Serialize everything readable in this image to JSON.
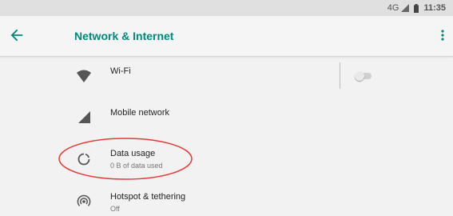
{
  "status_bar": {
    "network": "4G",
    "time": "11:35",
    "signal_icon": "signal-icon",
    "battery_icon": "battery-icon"
  },
  "app_bar": {
    "title": "Network & Internet",
    "back_icon": "arrow-back-icon",
    "overflow_icon": "more-vert-icon"
  },
  "colors": {
    "accent": "#00897b",
    "highlight": "#e53935"
  },
  "items": [
    {
      "label": "Wi-Fi",
      "summary": "",
      "icon": "wifi-icon",
      "toggle_on": false
    },
    {
      "label": "Mobile network",
      "summary": "",
      "icon": "signal-icon"
    },
    {
      "label": "Data usage",
      "summary": "0 B of data used",
      "icon": "data-usage-icon"
    },
    {
      "label": "Hotspot & tethering",
      "summary": "Off",
      "icon": "hotspot-icon"
    }
  ]
}
